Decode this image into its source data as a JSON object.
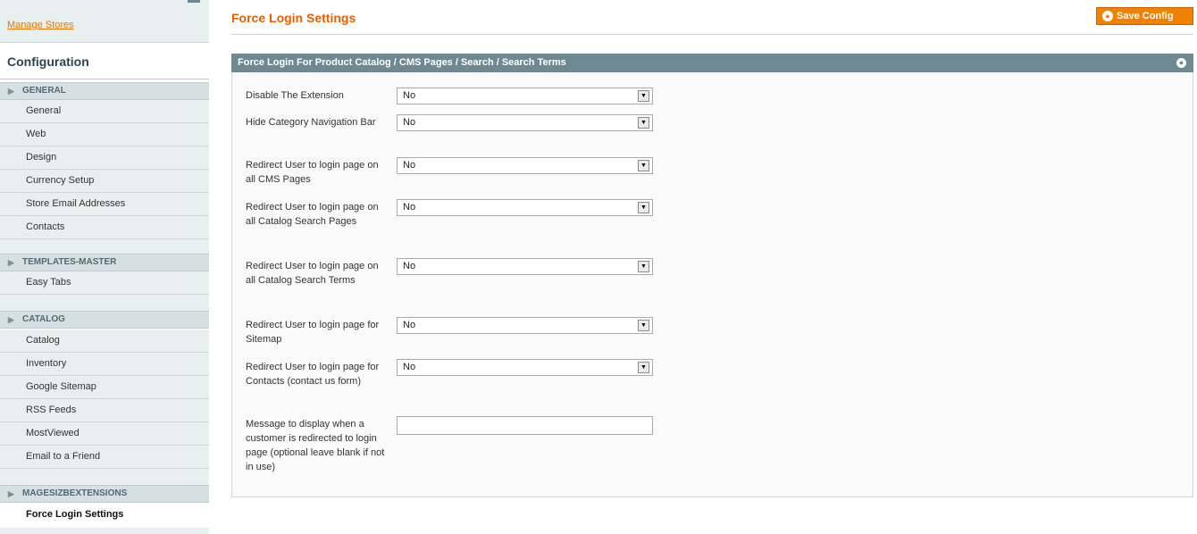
{
  "sidebar": {
    "manage_stores": "Manage Stores",
    "title": "Configuration",
    "groups": {
      "general": {
        "label": "GENERAL",
        "items": [
          "General",
          "Web",
          "Design",
          "Currency Setup",
          "Store Email Addresses",
          "Contacts"
        ]
      },
      "templates_master": {
        "label": "TEMPLATES-MASTER",
        "items": [
          "Easy Tabs"
        ]
      },
      "catalog": {
        "label": "CATALOG",
        "items": [
          "Catalog",
          "Inventory",
          "Google Sitemap",
          "RSS Feeds",
          "MostViewed",
          "Email to a Friend"
        ]
      },
      "magesiz": {
        "label": "MAGESIZBEXTENSIONS",
        "items": [
          "Force Login Settings"
        ]
      }
    }
  },
  "header": {
    "title": "Force Login Settings",
    "save_label": "Save Config"
  },
  "fieldset": {
    "title": "Force Login For Product Catalog / CMS Pages / Search / Search Terms",
    "fields": [
      {
        "label": "Disable The Extension",
        "value": "No"
      },
      {
        "label": "Hide Category Navigation Bar",
        "value": "No"
      },
      {
        "label": "Redirect User to login page on all CMS Pages",
        "value": "No"
      },
      {
        "label": "Redirect User to login page on all Catalog Search Pages",
        "value": "No"
      },
      {
        "label": "Redirect User to login page on all Catalog Search Terms",
        "value": "No"
      },
      {
        "label": "Redirect User to login page for Sitemap",
        "value": "No"
      },
      {
        "label": "Redirect User to login page for Contacts (contact us form)",
        "value": "No"
      }
    ],
    "message_label": "Message to display when a customer is redirected to login page (optional leave blank if not in use)",
    "message_value": ""
  },
  "colors": {
    "accent": "#eb5e00",
    "button": "#f18200",
    "fieldset_header": "#6f8992",
    "sidebar_bg": "#e7efef"
  }
}
